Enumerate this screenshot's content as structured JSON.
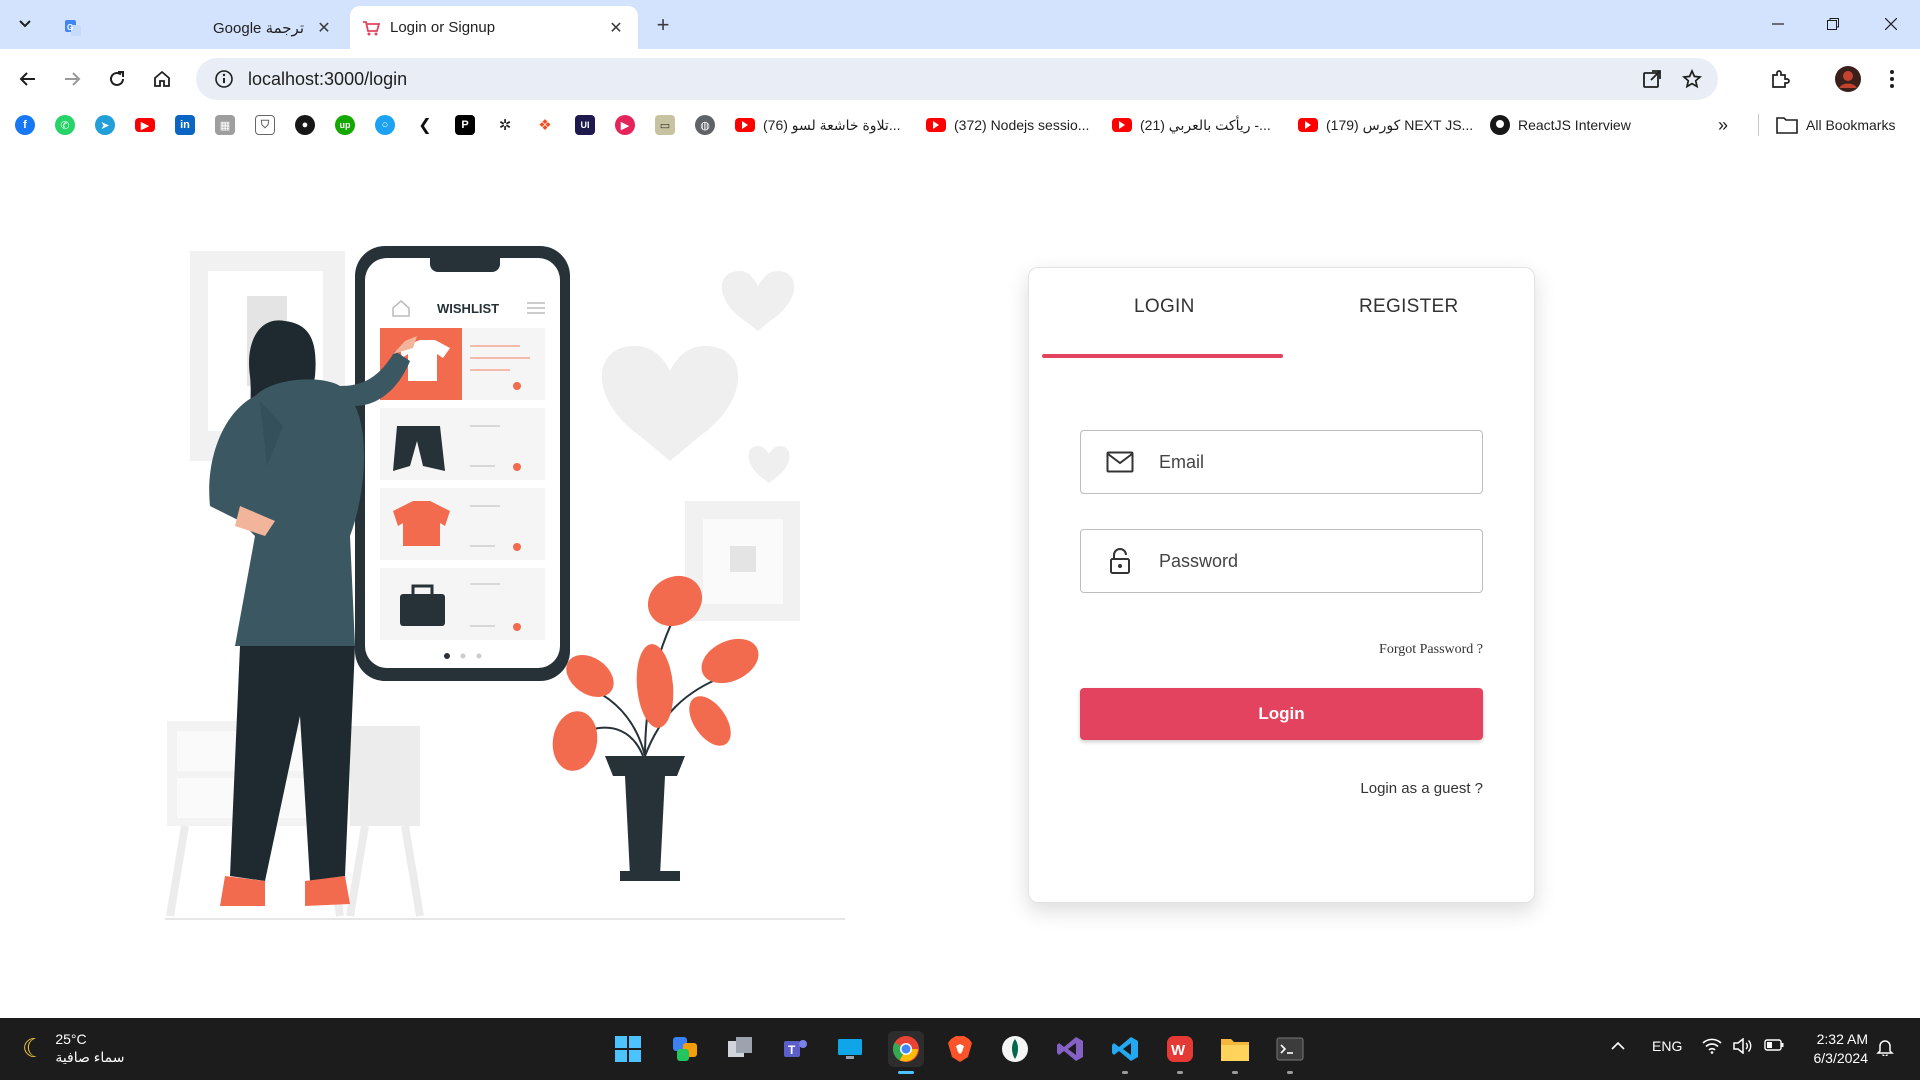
{
  "browser": {
    "tabs": [
      {
        "title": "Google ترجمة",
        "active": false
      },
      {
        "title": "Login or Signup",
        "active": true
      }
    ],
    "url": "localhost:3000/login",
    "bookmarks": [
      {
        "label": "(76) تلاوة خاشعة لسو..."
      },
      {
        "label": "(372) Nodejs sessio..."
      },
      {
        "label": "(21) ريأكت بالعربي -..."
      },
      {
        "label": "(179) كورس NEXT JS..."
      },
      {
        "label": "ReactJS Interview"
      }
    ],
    "all_bookmarks_label": "All Bookmarks"
  },
  "illustration": {
    "phone_header": "WISHLIST"
  },
  "auth": {
    "tabs": {
      "login": "LOGIN",
      "register": "REGISTER"
    },
    "email_placeholder": "Email",
    "password_placeholder": "Password",
    "forgot_password": "Forgot Password ?",
    "login_button": "Login",
    "guest_link": "Login as a guest ?",
    "accent_color": "#e3435f"
  },
  "taskbar": {
    "weather_temp": "25°C",
    "weather_desc": "سماء صافية",
    "language": "ENG",
    "time": "2:32 AM",
    "date": "6/3/2024"
  }
}
